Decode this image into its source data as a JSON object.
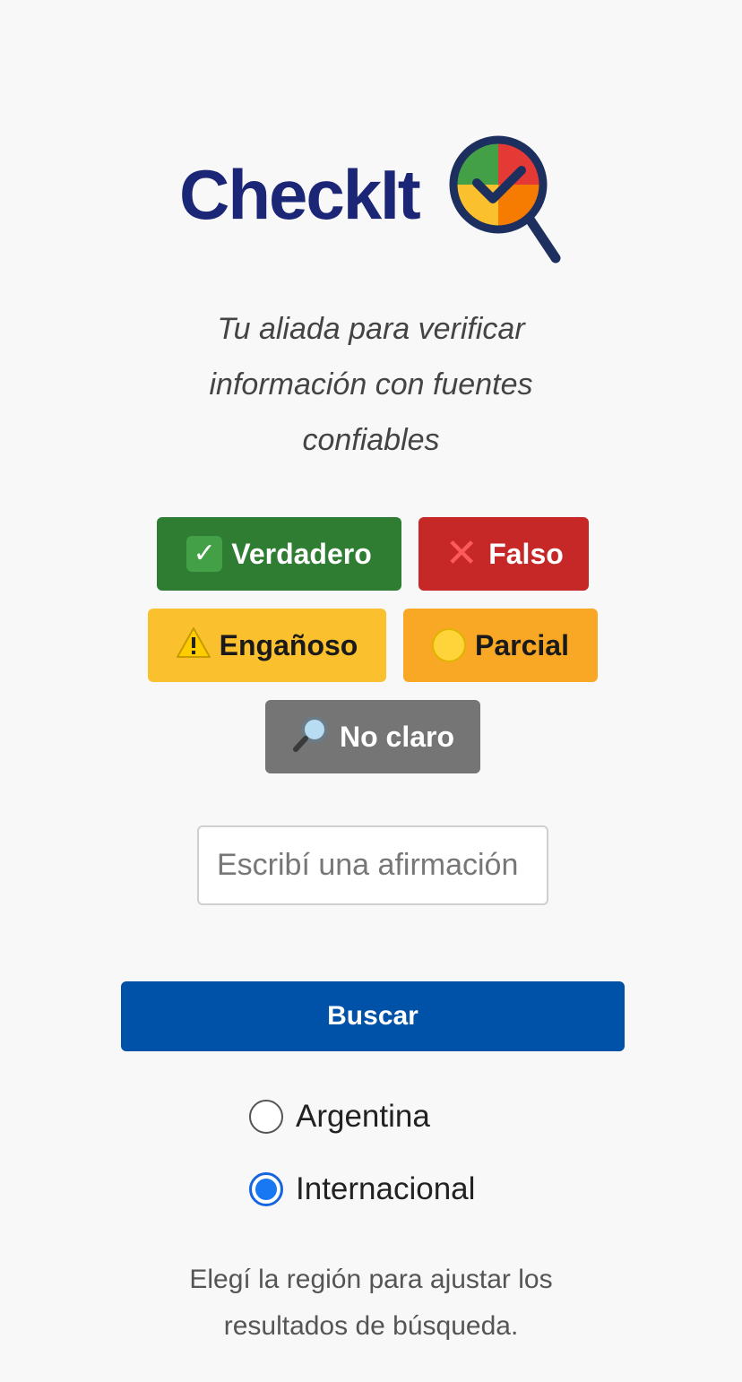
{
  "app": {
    "logo_text": "CheckIt",
    "tagline": "Tu aliada para verificar información con fuentes confiables"
  },
  "badges": [
    {
      "key": "true",
      "emoji": "check-mark-emoji",
      "label": "Verdadero",
      "color": "#2e7d32"
    },
    {
      "key": "false",
      "emoji": "cross-mark-emoji",
      "label": "Falso",
      "color": "#c62828"
    },
    {
      "key": "misleading",
      "emoji": "warning-emoji",
      "label": "Engañoso",
      "color": "#fbc02d"
    },
    {
      "key": "partial",
      "emoji": "yellow-circle-emoji",
      "label": "Parcial",
      "color": "#f9a825"
    },
    {
      "key": "unclear",
      "emoji": "magnifier-emoji",
      "label": "No claro",
      "color": "#757575"
    }
  ],
  "search": {
    "placeholder": "Escribí una afirmación",
    "value": "",
    "button_label": "Buscar",
    "button_color": "#0051a8"
  },
  "region": {
    "options": [
      {
        "label": "Argentina",
        "selected": false
      },
      {
        "label": "Internacional",
        "selected": true
      }
    ],
    "help_text": "Elegí la región para ajustar los resultados de búsqueda."
  }
}
